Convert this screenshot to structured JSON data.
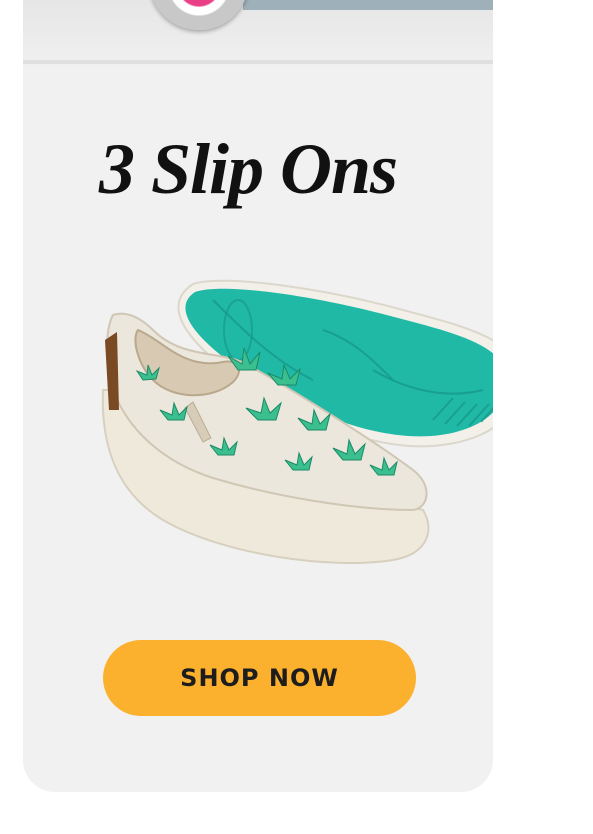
{
  "promo": {
    "title": "3 Slip Ons",
    "cta_label": "SHOP NOW"
  },
  "colors": {
    "card_background": "#f1f1f1",
    "cta_background": "#fbb12d",
    "sole_teal": "#1fb9a5",
    "canvas_cream": "#ece7dc",
    "leaf_green": "#3bbf8f"
  },
  "product_image": {
    "icon": "slip-on-shoe-pair-illustration"
  }
}
